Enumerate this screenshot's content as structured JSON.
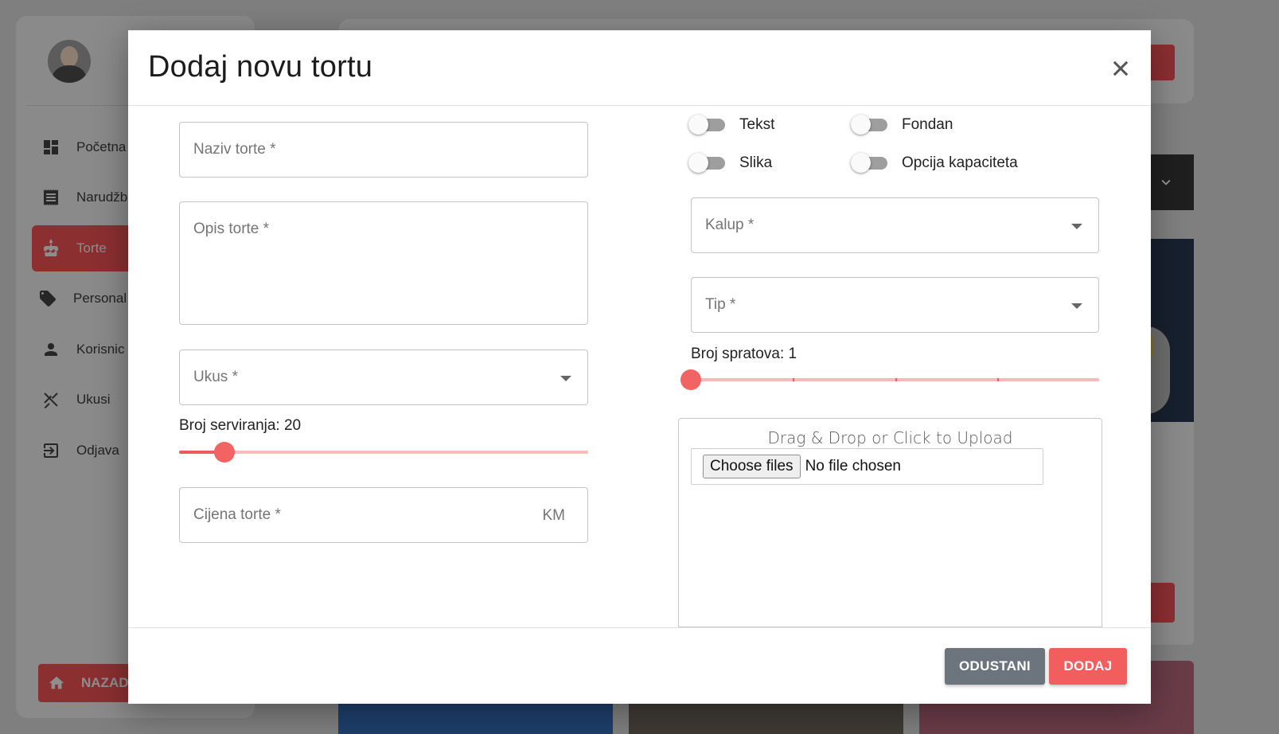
{
  "background": {
    "sidebar": {
      "items": [
        {
          "label": "Početna",
          "icon": "dashboard-icon"
        },
        {
          "label": "Narudžb",
          "icon": "receipt-icon"
        },
        {
          "label": "Torte",
          "icon": "cake-icon",
          "active": true
        },
        {
          "label": "Personal",
          "icon": "tag-icon"
        },
        {
          "label": "Korisnic",
          "icon": "person-icon"
        },
        {
          "label": "Ukusi",
          "icon": "utensils-icon"
        },
        {
          "label": "Odjava",
          "icon": "logout-icon"
        }
      ],
      "back_label": "NAZAD"
    }
  },
  "modal": {
    "title": "Dodaj novu tortu",
    "left": {
      "name_placeholder": "Naziv torte *",
      "description_placeholder": "Opis torte *",
      "flavor_placeholder": "Ukus *",
      "servings_label": "Broj serviranja: 20",
      "servings": {
        "value": 20,
        "min": 10,
        "max": 100
      },
      "price_placeholder": "Cijena torte *",
      "price_suffix": "KM"
    },
    "right": {
      "toggles": [
        {
          "label": "Tekst",
          "checked": false
        },
        {
          "label": "Fondan",
          "checked": false
        },
        {
          "label": "Slika",
          "checked": false
        },
        {
          "label": "Opcija kapaciteta",
          "checked": false
        }
      ],
      "mold_placeholder": "Kalup *",
      "type_placeholder": "Tip *",
      "tiers_label": "Broj spratova: 1",
      "tiers": {
        "value": 1,
        "min": 1,
        "max": 5
      },
      "upload_hint": "Drag & Drop or Click to Upload",
      "file_button": "Choose files",
      "file_status": "No file chosen"
    },
    "footer": {
      "cancel_label": "ODUSTANI",
      "add_label": "DODAJ"
    }
  },
  "colors": {
    "accent": "#f25e5e",
    "cancel": "#6c757d",
    "slider_track": "#f8b9b9"
  }
}
